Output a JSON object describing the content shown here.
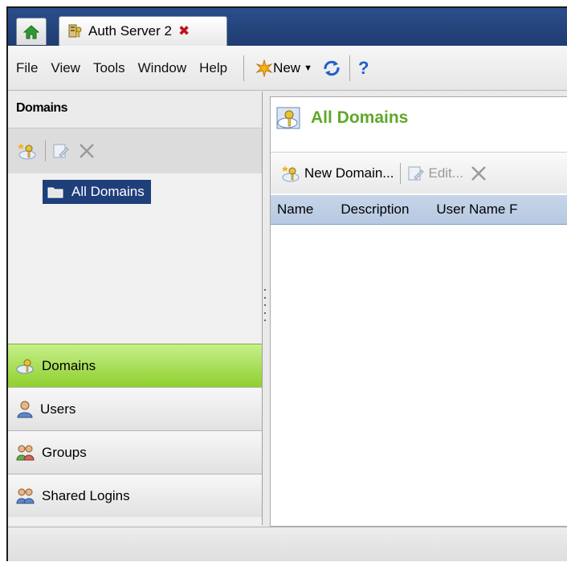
{
  "tabs": {
    "home_icon": "home-icon",
    "active": {
      "label": "Auth Server 2",
      "icon": "server-key-icon",
      "close_icon": "close-icon"
    }
  },
  "menu": {
    "items": [
      "File",
      "View",
      "Tools",
      "Window",
      "Help"
    ],
    "new_label": "New",
    "refresh_icon": "refresh-icon",
    "help_icon": "help-icon"
  },
  "left_panel": {
    "title": "Domains",
    "toolbar": [
      "new-domain-icon",
      "edit-icon",
      "delete-icon"
    ],
    "tree": {
      "selected_label": "All Domains"
    },
    "nav": [
      {
        "label": "Domains",
        "icon": "domains-icon",
        "active": true
      },
      {
        "label": "Users",
        "icon": "user-icon",
        "active": false
      },
      {
        "label": "Groups",
        "icon": "groups-icon",
        "active": false
      },
      {
        "label": "Shared Logins",
        "icon": "shared-logins-icon",
        "active": false
      }
    ]
  },
  "main": {
    "title": "All Domains",
    "toolbar": {
      "new_label": "New Domain...",
      "edit_label": "Edit..."
    },
    "columns": [
      "Name",
      "Description",
      "User Name F"
    ]
  },
  "colors": {
    "accent_green": "#5fa82a",
    "selection_blue": "#1e3f7a",
    "tab_strip": "#2b4e8a"
  }
}
